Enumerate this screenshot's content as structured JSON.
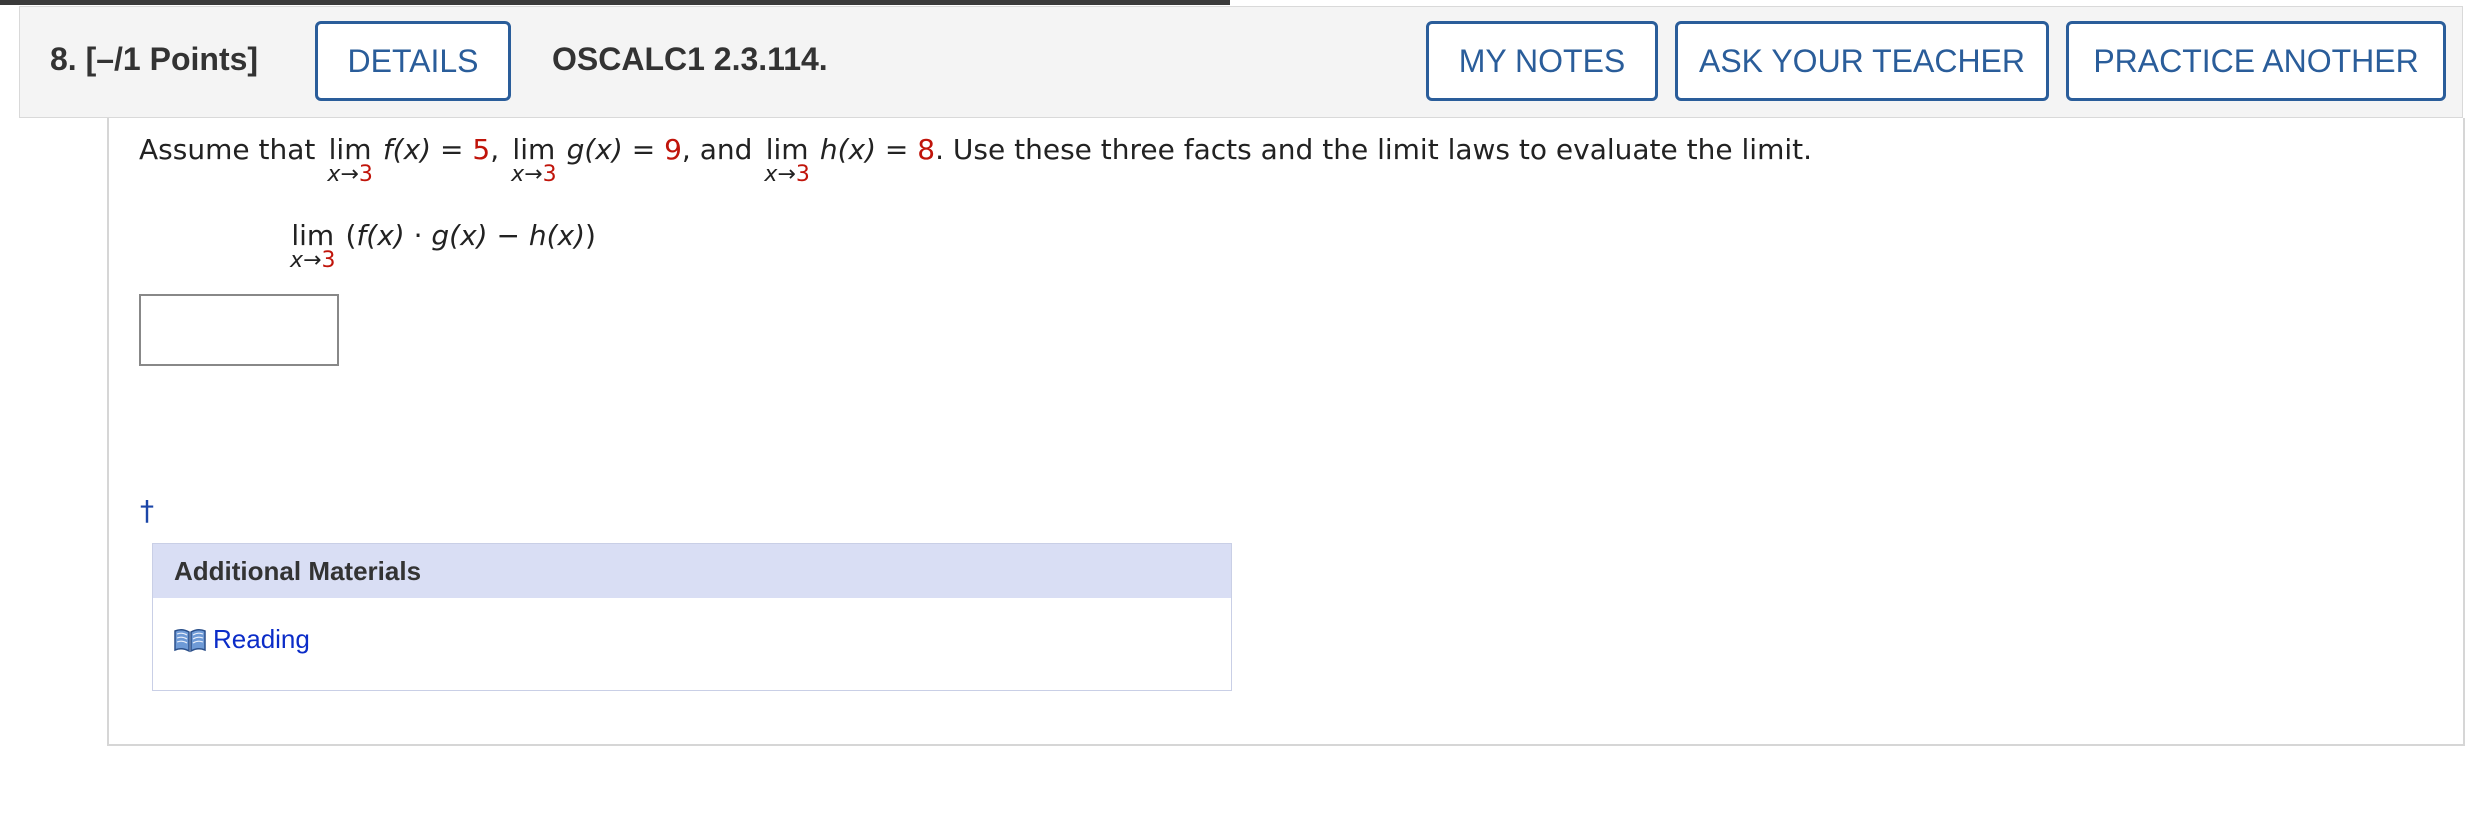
{
  "header": {
    "question_label": "8. [–/1 Points]",
    "details_label": "DETAILS",
    "assignment_code": "OSCALC1 2.3.114.",
    "my_notes_label": "MY NOTES",
    "ask_teacher_label": "ASK YOUR TEACHER",
    "practice_another_label": "PRACTICE ANOTHER"
  },
  "problem": {
    "intro": "Assume that",
    "lim_word": "lim",
    "sub_var": "x",
    "sub_arrow": "→",
    "sub_value": "3",
    "f_expr": "f(x)",
    "equals": "=",
    "f_value": "5",
    "comma1": ",",
    "g_expr": "g(x)",
    "g_value": "9",
    "and_text": ", and",
    "h_expr": "h(x)",
    "h_value": "8",
    "tail": ". Use these three facts and the limit laws to evaluate the limit.",
    "target_expr_open": "(",
    "target_f": "f(x)",
    "target_dot": " · ",
    "target_g": "g(x)",
    "target_minus": " − ",
    "target_h": "h(x)",
    "target_close": ")"
  },
  "answer": {
    "value": ""
  },
  "footnote": {
    "dagger": "†"
  },
  "materials": {
    "heading": "Additional Materials",
    "link_label": "Reading"
  },
  "colors": {
    "accent_blue": "#2a5d9a",
    "value_red": "#c0140a",
    "link_blue": "#0b2cc8",
    "materials_header_bg": "#d9def4"
  },
  "icons": {
    "reading": "book-icon"
  }
}
